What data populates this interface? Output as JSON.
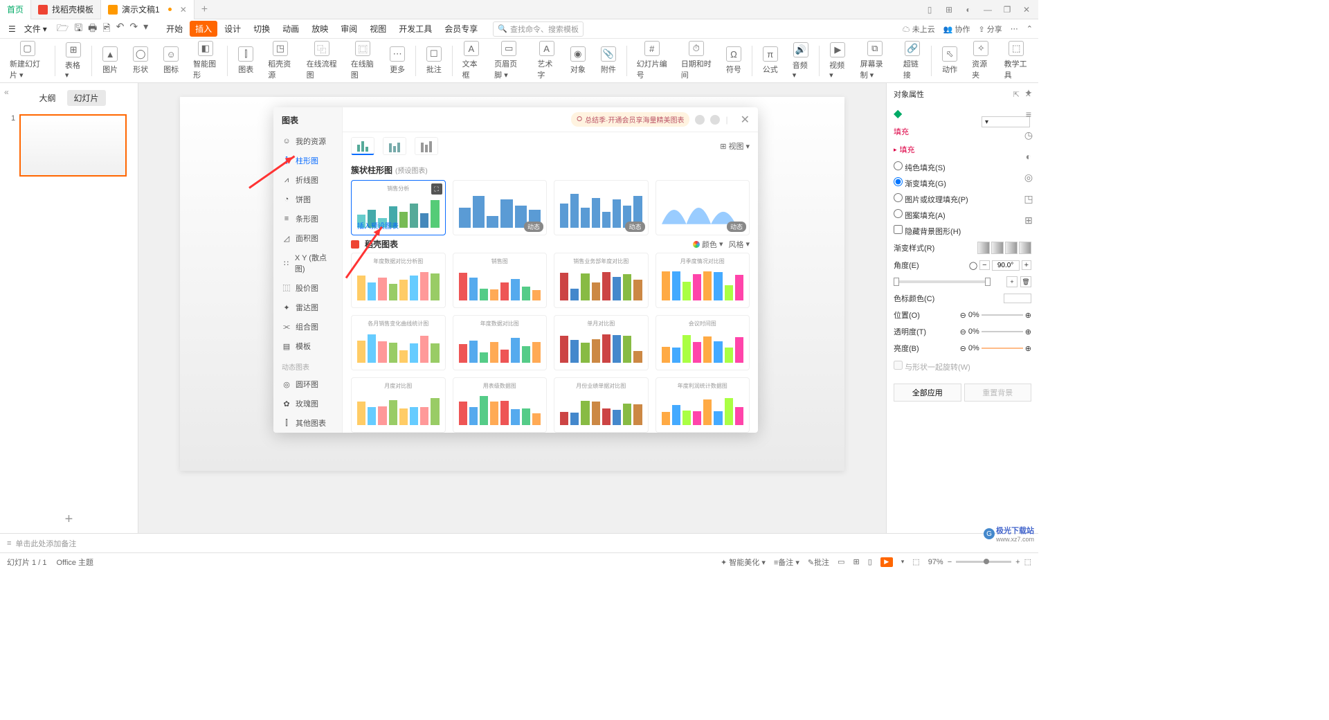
{
  "tabs": {
    "home": "首页",
    "t1": "找稻壳模板",
    "t2": "演示文稿1",
    "add": "+"
  },
  "winctl": [
    "▭",
    "⊞",
    "◐",
    "—",
    "❐",
    "✕"
  ],
  "file": "文件",
  "qat": [
    "☰",
    "🗁",
    "🗎",
    "🖶",
    "🖻",
    "↶",
    "↷",
    "▾"
  ],
  "menu": [
    "开始",
    "插入",
    "设计",
    "切换",
    "动画",
    "放映",
    "审阅",
    "视图",
    "开发工具",
    "会员专享"
  ],
  "search_ph": "查找命令、搜索模板",
  "rmenu": {
    "cloud": "未上云",
    "coop": "协作",
    "share": "分享"
  },
  "ribbon": [
    {
      "l": "新建幻灯片",
      "i": "▢"
    },
    {
      "l": "表格",
      "i": "⊞"
    },
    {
      "l": "图片",
      "i": "▲"
    },
    {
      "l": "形状",
      "i": "◯"
    },
    {
      "l": "图标",
      "i": "☺"
    },
    {
      "l": "智能图形",
      "i": "◧"
    },
    {
      "l": "图表",
      "i": "⫿"
    },
    {
      "l": "稻壳资源",
      "i": "◳"
    },
    {
      "l": "在线流程图",
      "i": "⿻"
    },
    {
      "l": "在线脑图",
      "i": "⿴"
    },
    {
      "l": "更多",
      "i": "⋯"
    },
    {
      "l": "批注",
      "i": "☐"
    },
    {
      "l": "文本框",
      "i": "A"
    },
    {
      "l": "页眉页脚",
      "i": "▭"
    },
    {
      "l": "艺术字",
      "i": "A"
    },
    {
      "l": "对象",
      "i": "◉"
    },
    {
      "l": "幻灯片编号",
      "i": "#"
    },
    {
      "l": "日期和时间",
      "i": "⏱"
    },
    {
      "l": "符号",
      "i": "Ω"
    },
    {
      "l": "公式",
      "i": "π"
    },
    {
      "l": "音频",
      "i": "🔊"
    },
    {
      "l": "视频",
      "i": "▶"
    },
    {
      "l": "屏幕录制",
      "i": "⧉"
    },
    {
      "l": "超链接",
      "i": "🔗"
    },
    {
      "l": "动作",
      "i": "⬁"
    },
    {
      "l": "资源夹",
      "i": "✧"
    },
    {
      "l": "教学工具",
      "i": "⬚"
    }
  ],
  "ribbon_attach": "附件",
  "outline": {
    "tabs": [
      "大纲",
      "幻灯片"
    ],
    "num": "1",
    "add": "+",
    "coll": "«"
  },
  "dialog": {
    "title": "图表",
    "side": [
      {
        "l": "我的资源",
        "i": "☺"
      },
      {
        "l": "柱形图",
        "i": "⫿"
      },
      {
        "l": "折线图",
        "i": "⩘"
      },
      {
        "l": "饼图",
        "i": "◔"
      },
      {
        "l": "条形图",
        "i": "≡"
      },
      {
        "l": "面积图",
        "i": "◿"
      },
      {
        "l": "X Y (散点图)",
        "i": "∷"
      },
      {
        "l": "股价图",
        "i": "⿲"
      },
      {
        "l": "雷达图",
        "i": "✦"
      },
      {
        "l": "组合图",
        "i": "⫘"
      },
      {
        "l": "模板",
        "i": "▤"
      }
    ],
    "side2_t": "动态图表",
    "side2": [
      {
        "l": "圆环图",
        "i": "◎"
      },
      {
        "l": "玫瑰图",
        "i": "✿"
      },
      {
        "l": "其他图表",
        "i": "⫿"
      }
    ],
    "promo": "总结季·开通会员享海量精美图表",
    "view": "视图",
    "sect1": "簇状柱形图",
    "sect1_sub": "(预设图表)",
    "insert": "插入预设图表",
    "badge": "动态",
    "sect2": "稻壳图表",
    "color": "颜色",
    "style": "风格",
    "card_titles": [
      "销售分析",
      "",
      "",
      "",
      "年度数据对比分析图",
      "销售图",
      "销售业务部年度对比图",
      "月季度情况对比图",
      "各月销售变化曲线统计图",
      "年度数据对比图",
      "单月对比图",
      "会议时间图",
      "月度对比图",
      "用表级数据图",
      "月份业绩单据对比图",
      "年度利润统计数据图"
    ]
  },
  "rpanel": {
    "title": "对象属性",
    "fill": "填充",
    "fillsec": "填充",
    "o1": "纯色填充(S)",
    "o2": "渐变填充(G)",
    "o3": "图片或纹理填充(P)",
    "o4": "图案填充(A)",
    "o5": "隐藏背景图形(H)",
    "grad": "渐变样式(R)",
    "angle": "角度(E)",
    "angle_v": "90.0°",
    "cstop": "色标颜色(C)",
    "pos": "位置(O)",
    "pos_v": "0%",
    "trans": "透明度(T)",
    "trans_v": "0%",
    "bright": "亮度(B)",
    "bright_v": "0%",
    "rot": "与形状一起旋转(W)",
    "btn1": "全部应用",
    "btn2": "重置背景"
  },
  "rtool": [
    "✦",
    "≡",
    "◷",
    "◐",
    "◎",
    "◳",
    "⊞"
  ],
  "notes": "单击此处添加备注",
  "status": {
    "slide": "幻灯片 1 / 1",
    "theme": "Office 主题",
    "beauty": "智能美化",
    "note": "备注",
    "cmt": "批注",
    "zoom": "97%",
    "fit": "⬚"
  },
  "watermark": {
    "t1": "极光下载站",
    "t2": "www.xz7.com"
  }
}
